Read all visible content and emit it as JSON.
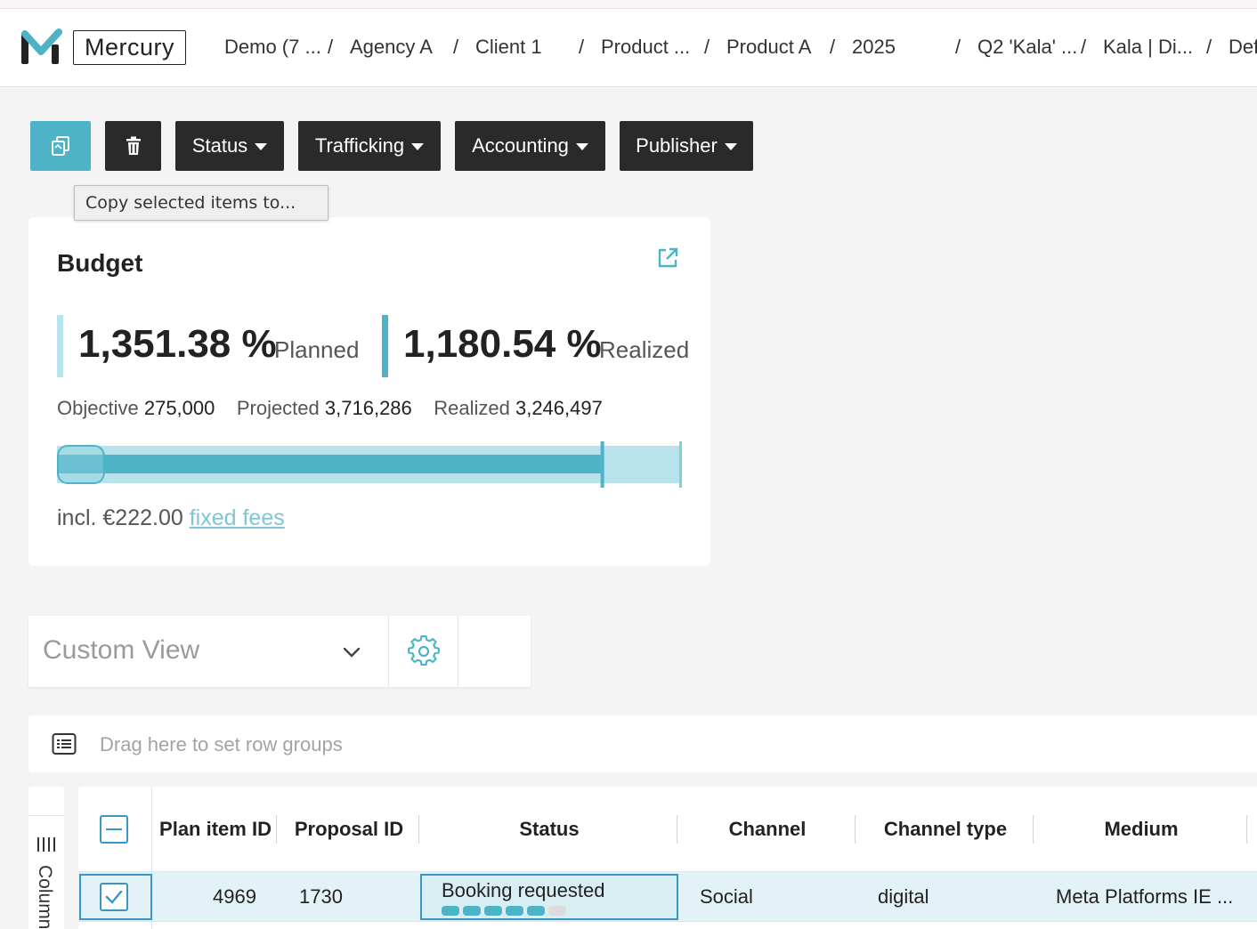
{
  "header": {
    "logo_text": "Mercury",
    "breadcrumbs": [
      "Demo (7 ...",
      "Agency A",
      "Client 1",
      "Product ...",
      "Product A",
      "2025",
      "Q2 'Kala' ...",
      "Kala | Di...",
      "Def"
    ],
    "separator": "/"
  },
  "toolbar": {
    "status_label": "Status",
    "trafficking_label": "Trafficking",
    "accounting_label": "Accounting",
    "publisher_label": "Publisher",
    "tooltip": "Copy selected items to..."
  },
  "budget": {
    "title": "Budget",
    "planned_value": "1,351.38 %",
    "planned_label": "Planned",
    "realized_value": "1,180.54 %",
    "realized_label": "Realized",
    "objective_label": "Objective",
    "objective_value": "275,000",
    "projected_label": "Projected",
    "projected_value": "3,716,286",
    "realized_stat_label": "Realized",
    "realized_stat_value": "3,246,497",
    "fees_prefix": "incl. €222.00",
    "fees_link": "fixed fees",
    "progress": {
      "objective": 275000,
      "projected": 3716286,
      "realized": 3246497
    }
  },
  "view": {
    "selected": "Custom View"
  },
  "row_groups": {
    "placeholder": "Drag here to set row groups"
  },
  "side_panel": {
    "label": "Columns"
  },
  "grid": {
    "columns": [
      "Plan item ID",
      "Proposal ID",
      "Status",
      "Channel",
      "Channel type",
      "Medium"
    ],
    "rows": [
      {
        "plan_item_id": "4969",
        "proposal_id": "1730",
        "status": "Booking requested",
        "status_steps_done": 5,
        "status_steps_total": 6,
        "channel": "Social",
        "channel_type": "digital",
        "medium": "Meta Platforms IE ..."
      }
    ]
  },
  "colors": {
    "accent": "#4fb3c8",
    "accent_light": "#b8e3ec",
    "dark_button": "#2a2a2a",
    "row_selected": "#e2f2f6"
  }
}
